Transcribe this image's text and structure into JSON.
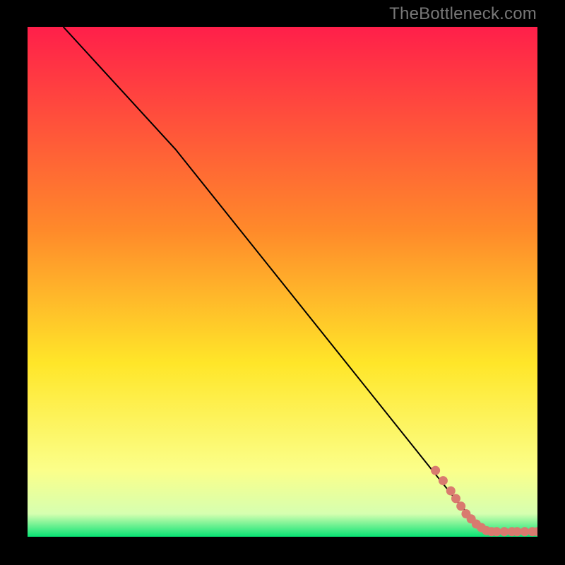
{
  "watermark": "TheBottleneck.com",
  "colors": {
    "gradient_top": "#ff1f4a",
    "gradient_mid_upper": "#ff8a2a",
    "gradient_mid": "#ffe629",
    "gradient_lower": "#fbff8a",
    "gradient_near_bottom": "#d6ffb0",
    "gradient_bottom": "#08e374",
    "line": "#000000",
    "marker": "#d97a6f",
    "frame": "#000000"
  },
  "chart_data": {
    "type": "line",
    "title": "",
    "xlabel": "",
    "ylabel": "",
    "xlim": [
      0,
      100
    ],
    "ylim": [
      0,
      100
    ],
    "series": [
      {
        "name": "curve",
        "x": [
          7,
          29,
          85,
          90,
          100
        ],
        "y": [
          100,
          76,
          6,
          1,
          1
        ]
      }
    ],
    "markers": {
      "name": "highlighted-points",
      "x": [
        80,
        81.5,
        83,
        84,
        85,
        86,
        87,
        88,
        89,
        90,
        91,
        92,
        93.5,
        95,
        96,
        97.5,
        99,
        100
      ],
      "y": [
        13,
        11,
        9,
        7.5,
        6,
        4.5,
        3.5,
        2.5,
        1.8,
        1.2,
        1,
        1,
        1,
        1,
        1,
        1,
        1,
        1
      ]
    }
  }
}
